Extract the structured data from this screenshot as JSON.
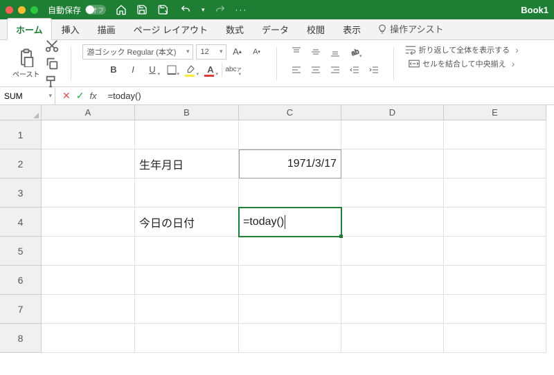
{
  "titlebar": {
    "autosave_label": "自動保存",
    "autosave_state": "オフ",
    "book_title": "Book1"
  },
  "tabs": {
    "items": [
      "ホーム",
      "挿入",
      "描画",
      "ページ レイアウト",
      "数式",
      "データ",
      "校閲",
      "表示"
    ],
    "tell_me": "操作アシスト",
    "active_index": 0
  },
  "ribbon": {
    "paste_label": "ペースト",
    "font_name": "游ゴシック Regular (本文)",
    "font_size": "12",
    "wrap_text": "折り返して全体を表示する",
    "merge_center": "セルを結合して中央揃え"
  },
  "formula_bar": {
    "name_box": "SUM",
    "formula": "=today()"
  },
  "sheet": {
    "columns": [
      "A",
      "B",
      "C",
      "D",
      "E"
    ],
    "rows": [
      "1",
      "2",
      "3",
      "4",
      "5",
      "6",
      "7",
      "8"
    ],
    "cells": {
      "B2": "生年月日",
      "C2": "1971/3/17",
      "B4": "今日の日付",
      "C4": "=today()"
    },
    "active_cell": "C4"
  }
}
